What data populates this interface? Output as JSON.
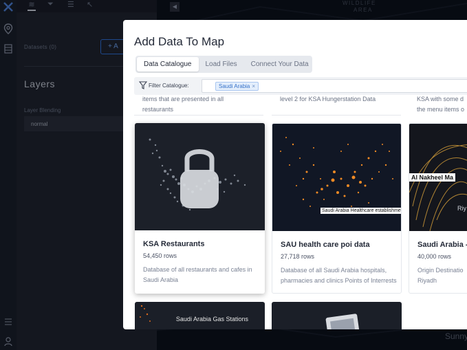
{
  "background": {
    "sidebar": {
      "datasets_label": "Datasets (0)",
      "add_button": "+ A",
      "layers_title": "Layers",
      "blend_label": "Layer Blending",
      "blend_value": "normal"
    },
    "map": {
      "labels": [
        "WILDLIFE",
        "AREA"
      ],
      "corner_text": "Sunny"
    }
  },
  "modal": {
    "title": "Add Data To Map",
    "tabs": [
      {
        "label": "Data Catalogue",
        "active": true
      },
      {
        "label": "Load Files",
        "active": false
      },
      {
        "label": "Connect Your Data",
        "active": false
      }
    ],
    "filter": {
      "label": "Filter Catalogue:",
      "chip": "Saudi Arabia",
      "chip_remove": "×"
    },
    "partial_rows": [
      {
        "line1": "items that are presented in all",
        "line2": "restaurants"
      },
      {
        "line1": "level 2 for KSA Hungerstation Data",
        "line2": ""
      },
      {
        "line1": "KSA with some d",
        "line2": "the menu items o"
      }
    ],
    "cards": [
      {
        "name": "KSA Restaurants",
        "rows": "54,450 rows",
        "desc": "Database of all restaurants and cafes in Saudi Arabia",
        "locked": true
      },
      {
        "name": "SAU health care poi data",
        "rows": "27,718 rows",
        "desc": "Database of all Saudi Arabia hospitals, pharmacies and clinics Points of Interrests",
        "image_caption": "Saudi Arabia Healthcare establishments"
      },
      {
        "name": "Saudi Arabia -",
        "rows": "40,000 rows",
        "desc": "Origin Destinatio Riyadh",
        "image_caption": "Al Nakheel Ma",
        "image_caption_2": "Riy"
      }
    ],
    "bottom_cards": [
      {
        "image_caption": "Saudi Arabia Gas Stations"
      },
      {
        "image_caption": ""
      }
    ],
    "colors": {
      "accent": "#3672c9",
      "heat_orange": "#f08a24"
    }
  }
}
